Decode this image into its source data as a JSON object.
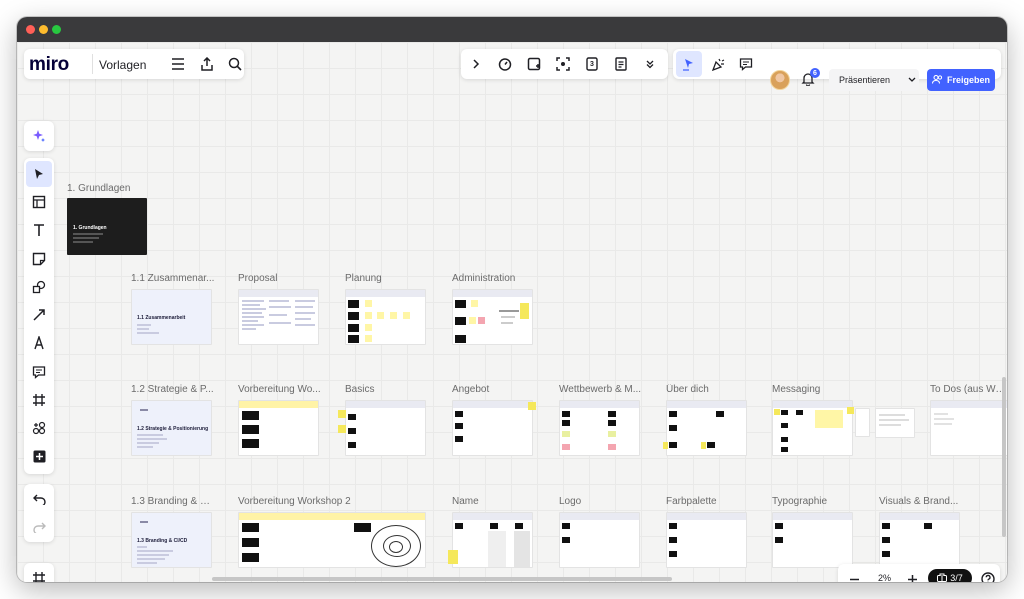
{
  "app": {
    "logo": "miro",
    "board_name": "Vorlagen"
  },
  "toolbar_right": {
    "present_label": "Präsentieren",
    "share_label": "Freigeben",
    "notification_count": "6",
    "timer_icon": "timer-icon",
    "counter_digit": "3"
  },
  "zoom": {
    "level": "2%",
    "page": "3/7"
  },
  "frames": {
    "grundlagen": {
      "label": "1. Grundlagen",
      "title": "1. Grundlagen"
    },
    "zusammenarbeit": {
      "label": "1.1 Zusammenar...",
      "title": "1.1 Zusammenarbeit"
    },
    "proposal": {
      "label": "Proposal"
    },
    "planung": {
      "label": "Planung"
    },
    "administration": {
      "label": "Administration"
    },
    "strategie": {
      "label": "1.2 Strategie & P...",
      "title": "1.2 Strategie & Positionierung"
    },
    "vorbereitung_ws1": {
      "label": "Vorbereitung Wo..."
    },
    "basics": {
      "label": "Basics"
    },
    "angebot": {
      "label": "Angebot"
    },
    "wettbewerb": {
      "label": "Wettbewerb & M..."
    },
    "ueber_dich": {
      "label": "Über dich"
    },
    "messaging": {
      "label": "Messaging"
    },
    "todos": {
      "label": "To Dos (aus Wor..."
    },
    "branding": {
      "label": "1.3 Branding & Cl...",
      "title": "1.3 Branding & CI/CD"
    },
    "vorbereitung_ws2": {
      "label": "Vorbereitung Workshop 2"
    },
    "name": {
      "label": "Name"
    },
    "logo": {
      "label": "Logo"
    },
    "farbpalette": {
      "label": "Farbpalette"
    },
    "typographie": {
      "label": "Typographie"
    },
    "visuals": {
      "label": "Visuals & Brand..."
    }
  },
  "colors": {
    "accent": "#4262ff",
    "sticky_yellow": "#f5e85b",
    "sticky_pink": "#f4a5b0",
    "canvas": "#f4f4f3"
  }
}
